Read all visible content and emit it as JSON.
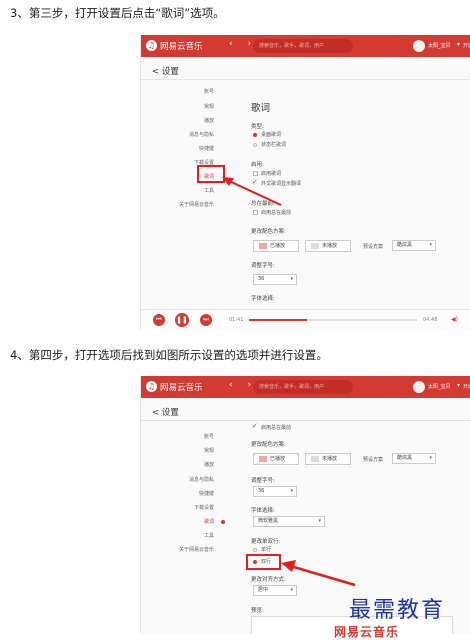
{
  "steps": {
    "step3": "3、第三步，打开设置后点击“歌词”选项。",
    "step4": "4、第四步，打开选项后找到如图所示设置的选项并进行设置。"
  },
  "colors": {
    "brand": "#d33a31",
    "highlight": "#e02020",
    "watermark": "#1b34a8"
  },
  "app": {
    "name": "网易云音乐",
    "search_placeholder": "搜索音乐，歌手，歌词，用户",
    "username": "太阳_宝贝",
    "extra": "开通",
    "settings_title": "< 设置"
  },
  "sidebar1": [
    "账号",
    "常规",
    "播放",
    "消息与隐私",
    "快捷键",
    "下载设置",
    "歌词",
    "工具",
    "关于网易云音乐"
  ],
  "sidebar2": [
    "账号",
    "常规",
    "播放",
    "消息与隐私",
    "快捷键",
    "下载设置",
    "歌词",
    "工具",
    "关于网易云音乐"
  ],
  "lyrics": {
    "heading": "歌词",
    "type_label": "类型:",
    "type_desktop": "桌面歌词",
    "type_menubar": "状态栏歌词",
    "enable_label": "启用:",
    "enable_startup": "启用歌词",
    "enable_translate": "外文歌词显示翻译",
    "always_label": "总在最前:",
    "always_on_top": "启用总在最前",
    "scheme_label": "更改配色方案:",
    "played": "已播放",
    "unplayed": "未播放",
    "preset_label": "预设方案",
    "preset_value": "酷炫黑",
    "size_label": "调整字号:",
    "size_value": "36",
    "font_label": "字体选择:",
    "font_value": "微软雅黑",
    "lines_label": "更改单双行:",
    "single_line": "单行",
    "double_line": "双行",
    "align_label": "更改对齐方式:",
    "align_value": "居中",
    "preview_label": "预览:",
    "preview_logo": "网易云音乐"
  },
  "player": {
    "time_current": "01:41",
    "time_total": "04:48"
  },
  "watermark": "最需教育"
}
